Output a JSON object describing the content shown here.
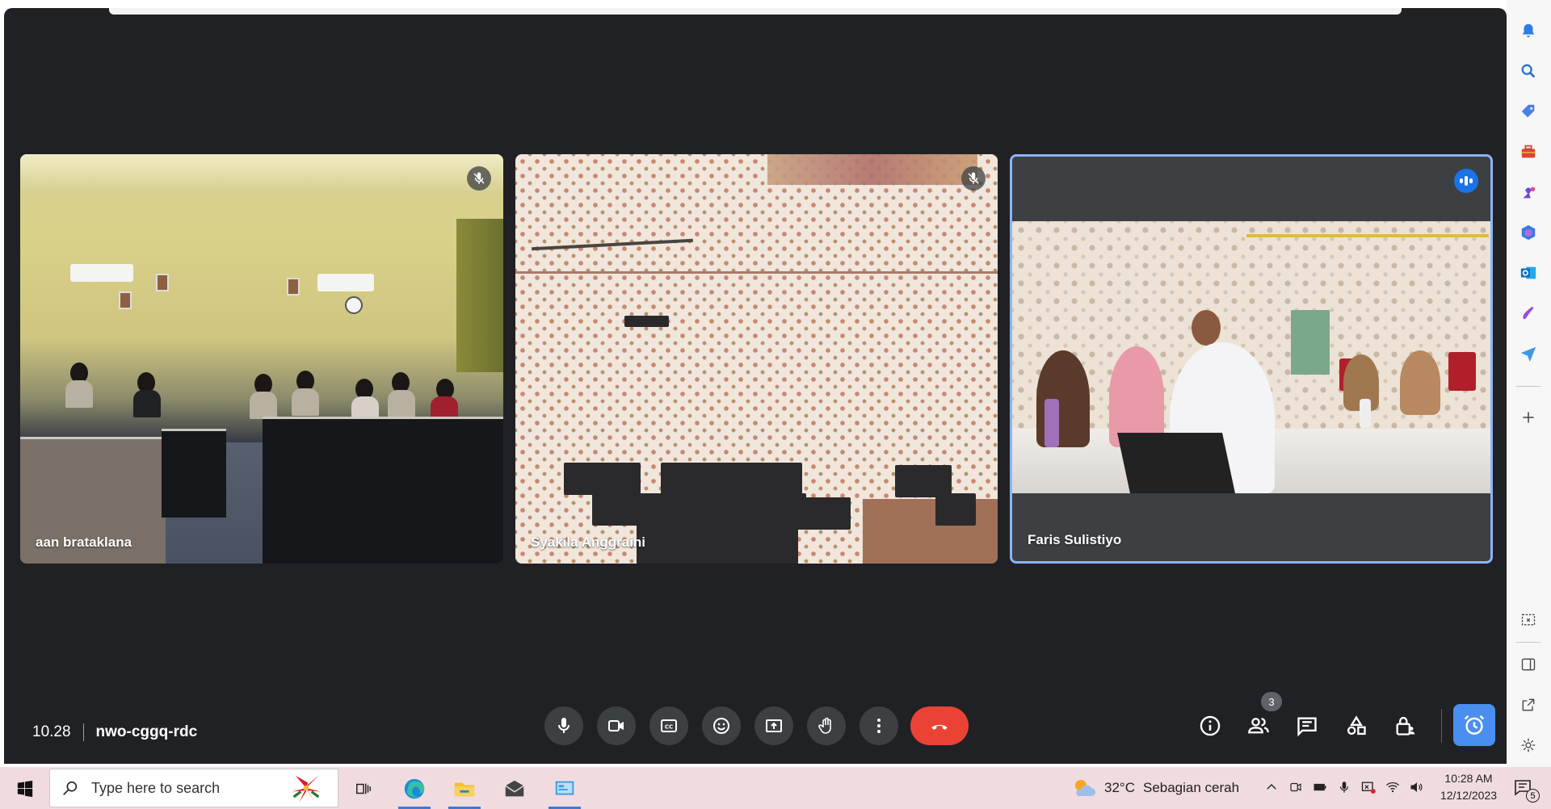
{
  "meeting": {
    "time": "10.28",
    "code": "nwo-cggq-rdc"
  },
  "participants": [
    {
      "name": "aan brataklana",
      "muted": true
    },
    {
      "name": "Syakila Anggraini",
      "muted": true
    },
    {
      "name": "Faris Sulistiyo",
      "speaking": true
    }
  ],
  "controls": {
    "people_count": "3",
    "colors": {
      "end_call": "#ea4335",
      "accent": "#1a73e8",
      "active_border": "#8ab4f8"
    }
  },
  "taskbar": {
    "search_placeholder": "Type here to search",
    "weather_temp": "32°C",
    "weather_desc": "Sebagian cerah",
    "time": "10:28 AM",
    "date": "12/12/2023",
    "notification_count": "5"
  }
}
